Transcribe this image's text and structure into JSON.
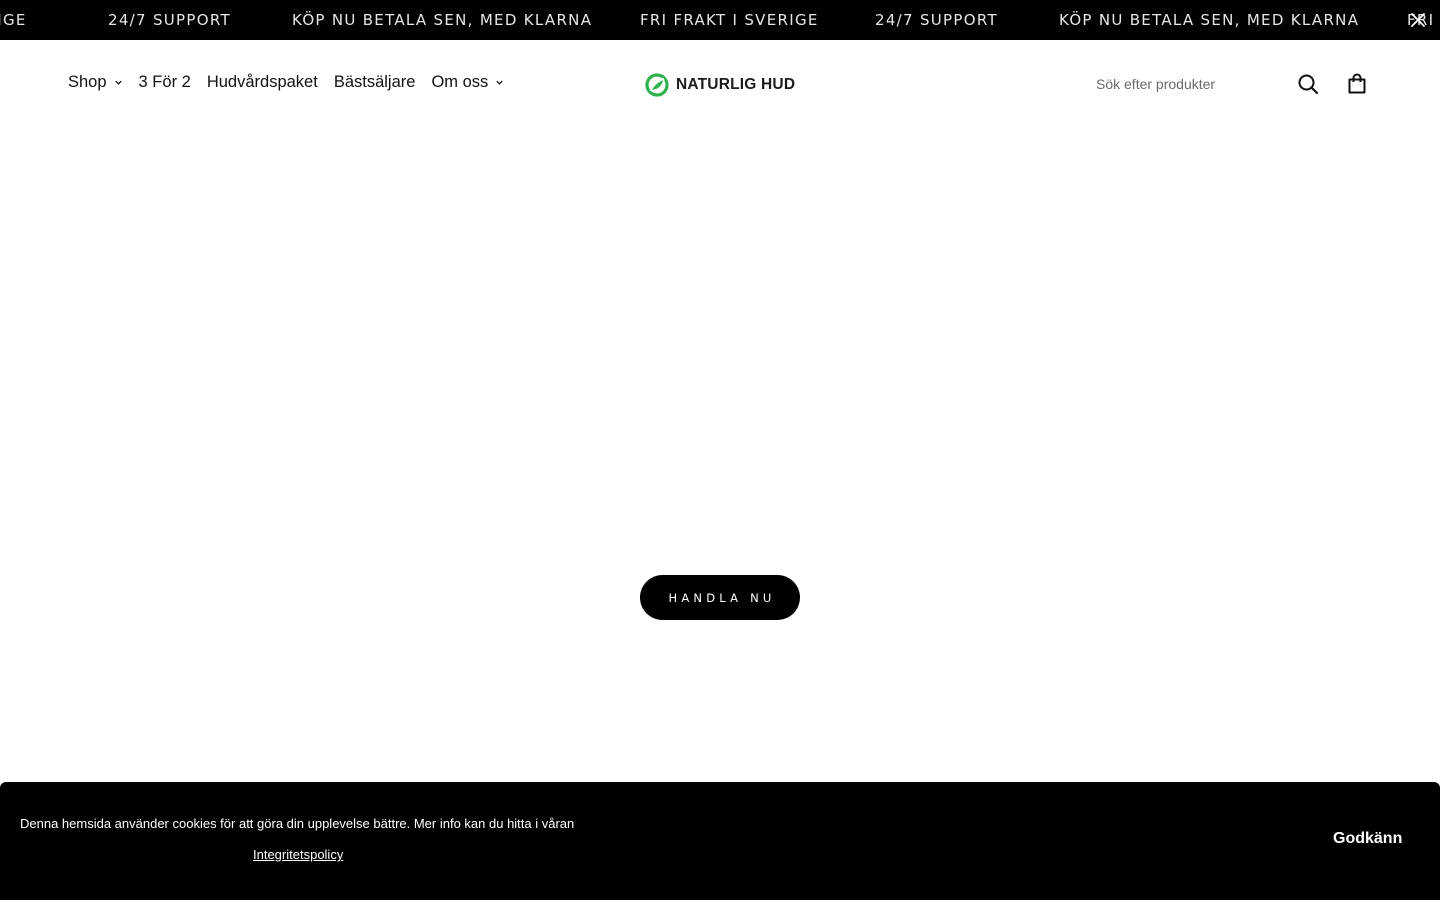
{
  "announcement": {
    "items": [
      "FRI FRAKT I SVERIGE",
      "24/7 SUPPORT",
      "KÖP NU BETALA SEN, MED KLARNA",
      "FRI FRAKT I SVERIGE",
      "24/7 SUPPORT",
      "KÖP NU BETALA SEN, MED KLARNA",
      "FRI FRAKT I SVERIGE"
    ],
    "close_icon": "close-icon"
  },
  "header": {
    "nav": [
      {
        "label": "Shop",
        "has_dropdown": true
      },
      {
        "label": "3 För 2",
        "has_dropdown": false
      },
      {
        "label": "Hudvårdspaket",
        "has_dropdown": false
      },
      {
        "label": "Bästsäljare",
        "has_dropdown": false
      },
      {
        "label": "Om oss",
        "has_dropdown": true
      }
    ],
    "logo_text": "NATURLIG HUD",
    "search": {
      "placeholder": "Sök efter produkter",
      "value": ""
    },
    "icons": {
      "search": "search-icon",
      "cart": "shopping-bag-icon"
    }
  },
  "hero": {
    "cta_label": "HANDLA NU"
  },
  "cookie_banner": {
    "text": "Denna hemsida använder cookies för att göra din upplevelse bättre. Mer info kan du hitta i våran",
    "link_label": "Integritetspolicy",
    "accept_label": "Godkänn"
  },
  "colors": {
    "announcement_bg": "#000000",
    "brand_green": "#2fb24e",
    "cta_bg": "#000000",
    "cookie_bg": "#000000"
  }
}
